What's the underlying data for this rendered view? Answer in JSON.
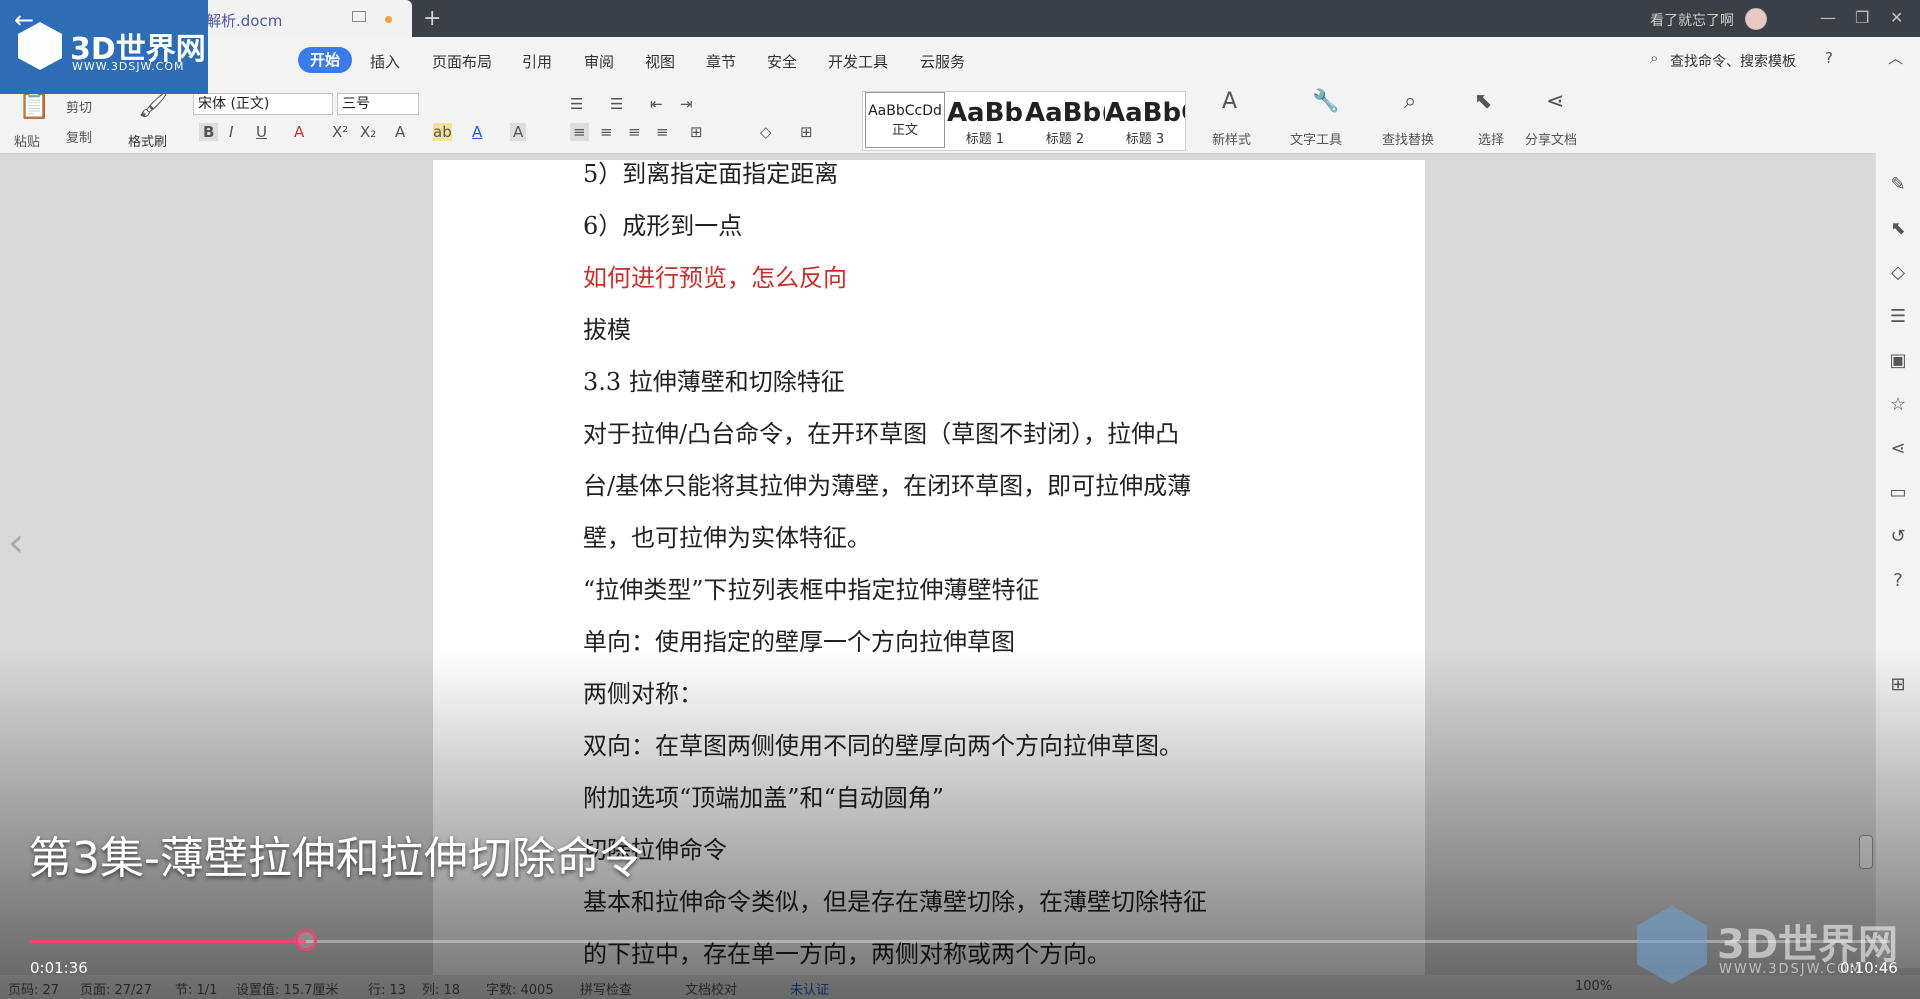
{
  "titlebar": {
    "doc_name": "解析.docm",
    "new_tab": "+",
    "account": "看了就忘了啊",
    "min": "—",
    "max": "❐",
    "close": "✕"
  },
  "menu": {
    "items": [
      "开始",
      "插入",
      "页面布局",
      "引用",
      "审阅",
      "视图",
      "章节",
      "安全",
      "开发工具",
      "云服务"
    ],
    "search": "查找命令、搜索模板"
  },
  "toolbar": {
    "paste": "粘贴",
    "cut": "剪切",
    "copy": "复制",
    "format_painter": "格式刷",
    "font_name": "宋体 (正文)",
    "font_size": "三号",
    "styles": [
      {
        "preview": "AaBbCcDd",
        "label": "正文"
      },
      {
        "preview": "AaBb",
        "label": "标题 1"
      },
      {
        "preview": "AaBb(",
        "label": "标题 2"
      },
      {
        "preview": "AaBbC(",
        "label": "标题 3"
      }
    ],
    "new_style": "新样式",
    "text_tools": "文字工具",
    "find_replace": "查找替换",
    "select": "选择",
    "share": "分享文档"
  },
  "document": {
    "lines": [
      {
        "text": "5）到离指定面指定距离",
        "red": false
      },
      {
        "text": "6）成形到一点",
        "red": false
      },
      {
        "text": "如何进行预览，怎么反向",
        "red": true
      },
      {
        "text": "拔模",
        "red": false
      },
      {
        "text": "3.3 拉伸薄壁和切除特征",
        "red": false
      },
      {
        "text": "对于拉伸/凸台命令，在开环草图（草图不封闭），拉伸凸",
        "red": false
      },
      {
        "text": "台/基体只能将其拉伸为薄壁，在闭环草图，即可拉伸成薄",
        "red": false
      },
      {
        "text": "壁，也可拉伸为实体特征。",
        "red": false
      },
      {
        "text": "“拉伸类型”下拉列表框中指定拉伸薄壁特征",
        "red": false
      },
      {
        "text": "单向：使用指定的壁厚一个方向拉伸草图",
        "red": false
      },
      {
        "text": "两侧对称：",
        "red": false
      },
      {
        "text": "双向：在草图两侧使用不同的壁厚向两个方向拉伸草图。",
        "red": false
      },
      {
        "text": "附加选项“顶端加盖”和“自动圆角”",
        "red": false
      },
      {
        "text": "切除拉伸命令",
        "red": false
      },
      {
        "text": "基本和拉伸命令类似，但是存在薄壁切除，在薄壁切除特征",
        "red": false
      },
      {
        "text": "的下拉中，存在单一方向，两侧对称或两个方向。",
        "red": false
      }
    ]
  },
  "status": {
    "page": "页码: 27",
    "pages": "页面: 27/27",
    "section": "节: 1/1",
    "setting": "设置值: 15.7厘米",
    "row": "行: 13",
    "col": "列: 18",
    "words": "字数: 4005",
    "spell": "拼写检查",
    "proof": "文档校对",
    "auth": "未认证",
    "zoom": "100%"
  },
  "video": {
    "episode_title": "第3集-薄壁拉伸和拉伸切除命令",
    "current_time": "0:01:36",
    "total_time": "0:10:46",
    "progress_fraction": 0.1486
  },
  "watermark": {
    "brand": "3D世界网",
    "url": "WWW.3DSJW.COM"
  },
  "colors": {
    "accent": "#3b7be8",
    "progress": "#e8486f",
    "heading_red": "#c9302c"
  }
}
